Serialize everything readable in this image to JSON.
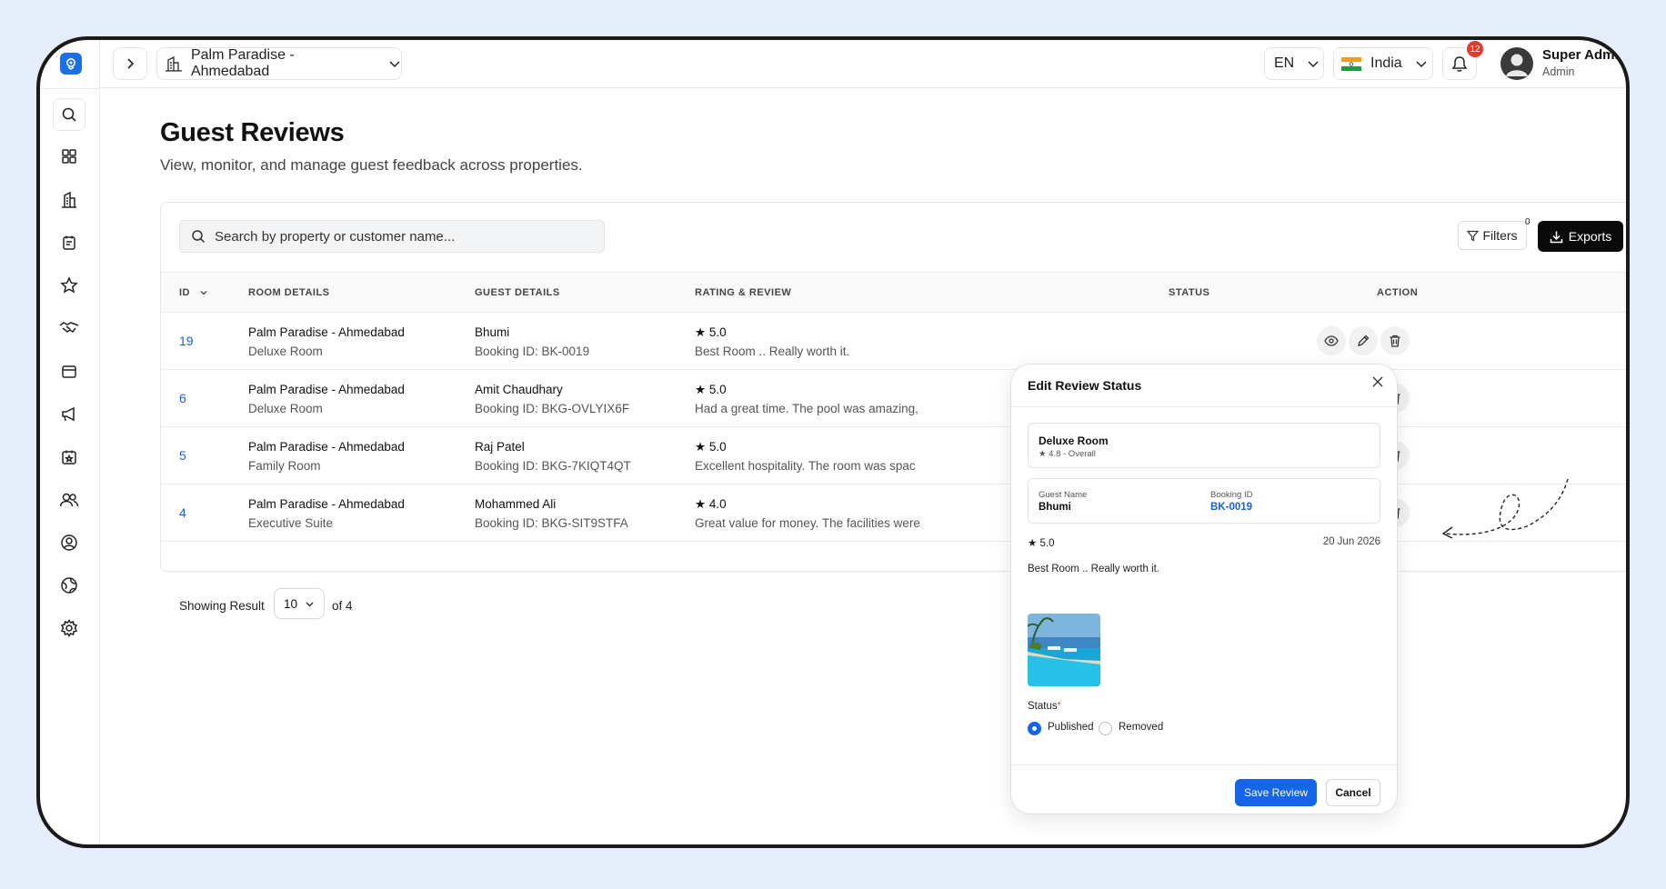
{
  "topbar": {
    "property": "Palm Paradise - Ahmedabad",
    "language": "EN",
    "country": "India",
    "notification_count": "12",
    "user_name": "Super Admin",
    "user_role": "Admin"
  },
  "page": {
    "title": "Guest Reviews",
    "subtitle": "View, monitor, and manage guest feedback across properties."
  },
  "toolbar": {
    "search_placeholder": "Search by property or customer name...",
    "filters_label": "Filters",
    "filters_count": "0",
    "exports_label": "Exports"
  },
  "table": {
    "headers": {
      "id": "ID",
      "room": "ROOM DETAILS",
      "guest": "GUEST DETAILS",
      "rating": "RATING & REVIEW",
      "status": "STATUS",
      "action": "ACTION"
    },
    "rows": [
      {
        "id": "19",
        "property": "Palm Paradise - Ahmedabad",
        "room": "Deluxe Room",
        "guest": "Bhumi",
        "booking": "Booking ID: BK-0019",
        "rating": "★ 5.0",
        "review": "Best Room .. Really worth it."
      },
      {
        "id": "6",
        "property": "Palm Paradise - Ahmedabad",
        "room": "Deluxe Room",
        "guest": "Amit Chaudhary",
        "booking": "Booking ID: BKG-OVLYIX6F",
        "rating": "★ 5.0",
        "review": "Had a great time. The pool was amazing,"
      },
      {
        "id": "5",
        "property": "Palm Paradise - Ahmedabad",
        "room": "Family Room",
        "guest": "Raj Patel",
        "booking": "Booking ID: BKG-7KIQT4QT",
        "rating": "★ 5.0",
        "review": "Excellent hospitality. The room was spac"
      },
      {
        "id": "4",
        "property": "Palm Paradise - Ahmedabad",
        "room": "Executive Suite",
        "guest": "Mohammed Ali",
        "booking": "Booking ID: BKG-SIT9STFA",
        "rating": "★ 4.0",
        "review": "Great value for money. The facilities were"
      }
    ]
  },
  "footer": {
    "showing_label": "Showing Result",
    "page_size": "10",
    "of_total": "of 4"
  },
  "modal": {
    "title": "Edit Review Status",
    "room_name": "Deluxe Room",
    "room_rating": "★ 4.8 - Overall",
    "guest_name_label": "Guest Name",
    "guest_name": "Bhumi",
    "booking_id_label": "Booking ID",
    "booking_id": "BK-0019",
    "rating": "★ 5.0",
    "date": "20 Jun 2026",
    "review": "Best Room .. Really worth it.",
    "status_label": "Status",
    "required_mark": "*",
    "option_published": "Published",
    "option_removed": "Removed",
    "save_label": "Save Review",
    "cancel_label": "Cancel"
  },
  "colors": {
    "accent": "#1565e8",
    "link": "#1d5fd0",
    "badge": "#e03b2d",
    "background": "#e6eefb"
  }
}
